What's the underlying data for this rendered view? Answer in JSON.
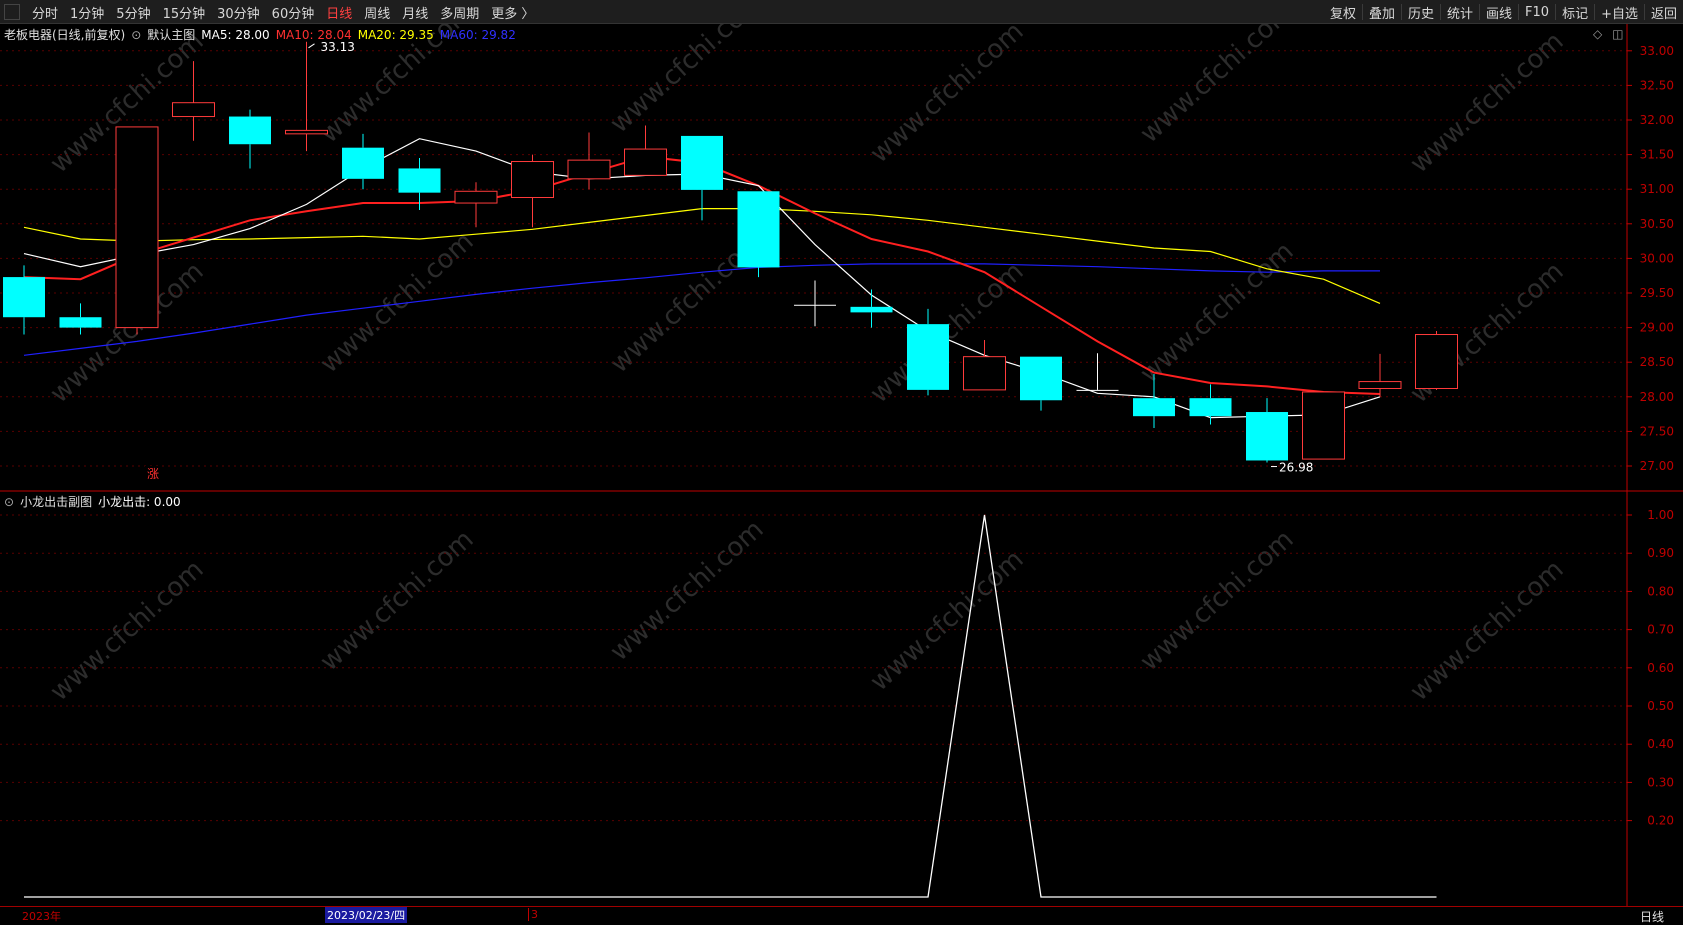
{
  "toolbar": {
    "left": [
      "分时",
      "1分钟",
      "5分钟",
      "15分钟",
      "30分钟",
      "60分钟",
      "日线",
      "周线",
      "月线",
      "多周期",
      "更多 〉"
    ],
    "active": "日线",
    "right": [
      "复权",
      "叠加",
      "历史",
      "统计",
      "画线",
      "F10",
      "标记",
      "+自选",
      "返回"
    ]
  },
  "main_header": {
    "stock": "老板电器(日线,前复权)",
    "template": "默认主图",
    "ma5": "MA5: 28.00",
    "ma10": "MA10: 28.04",
    "ma20": "MA20: 29.35",
    "ma60": "MA60: 29.82"
  },
  "sub_header": {
    "name": "小龙出击副图",
    "value": "小龙出击: 0.00"
  },
  "annotations": {
    "high_label": "33.13",
    "low_label": "26.98",
    "zhang_marker": "涨"
  },
  "bottom": {
    "year": "2023年",
    "cursor_date": "2023/02/23/四",
    "month": "3",
    "period": "日线"
  },
  "watermark": "www.cfchi.com",
  "colors": {
    "up": "#ff3b3b",
    "down": "#00ffff",
    "ma5": "#ffffff",
    "ma10": "#ff2020",
    "ma20": "#ffff00",
    "ma60": "#2020ff",
    "axis": "#c00000"
  },
  "chart_data": [
    {
      "type": "candlestick",
      "title": "老板电器(日线,前复权)",
      "ylim": [
        26.7,
        33.3
      ],
      "y_ticks": [
        "27.00",
        "27.50",
        "28.00",
        "28.50",
        "29.00",
        "29.50",
        "30.00",
        "30.50",
        "31.00",
        "31.50",
        "32.00",
        "32.50",
        "33.00"
      ],
      "candles": [
        {
          "open": 29.73,
          "close": 29.15,
          "high": 29.9,
          "low": 28.9
        },
        {
          "open": 29.15,
          "close": 29.0,
          "high": 29.35,
          "low": 28.9
        },
        {
          "open": 29.0,
          "close": 31.9,
          "high": 31.9,
          "low": 28.9
        },
        {
          "open": 32.05,
          "close": 32.25,
          "high": 32.85,
          "low": 31.7
        },
        {
          "open": 32.05,
          "close": 31.65,
          "high": 32.15,
          "low": 31.3
        },
        {
          "open": 31.8,
          "close": 31.85,
          "high": 33.13,
          "low": 31.55
        },
        {
          "open": 31.6,
          "close": 31.15,
          "high": 31.8,
          "low": 31.0
        },
        {
          "open": 31.3,
          "close": 30.95,
          "high": 31.45,
          "low": 30.7
        },
        {
          "open": 30.8,
          "close": 30.97,
          "high": 31.1,
          "low": 30.45
        },
        {
          "open": 30.88,
          "close": 31.4,
          "high": 31.5,
          "low": 30.45
        },
        {
          "open": 31.15,
          "close": 31.42,
          "high": 31.82,
          "low": 31.0
        },
        {
          "open": 31.2,
          "close": 31.58,
          "high": 31.92,
          "low": 31.2
        },
        {
          "open": 31.77,
          "close": 30.99,
          "high": 31.77,
          "low": 30.55
        },
        {
          "open": 30.97,
          "close": 29.87,
          "high": 30.97,
          "low": 29.73
        },
        {
          "open": 29.33,
          "close": 29.33,
          "high": 29.68,
          "low": 29.02
        },
        {
          "open": 29.3,
          "close": 29.22,
          "high": 29.55,
          "low": 29.0
        },
        {
          "open": 29.05,
          "close": 28.1,
          "high": 29.27,
          "low": 28.02
        },
        {
          "open": 28.1,
          "close": 28.58,
          "high": 28.82,
          "low": 28.1
        },
        {
          "open": 28.58,
          "close": 27.95,
          "high": 28.58,
          "low": 27.8
        },
        {
          "open": 28.1,
          "close": 28.1,
          "high": 28.63,
          "low": 28.1
        },
        {
          "open": 27.98,
          "close": 27.72,
          "high": 28.33,
          "low": 27.55
        },
        {
          "open": 27.98,
          "close": 27.72,
          "high": 28.18,
          "low": 27.6
        },
        {
          "open": 27.78,
          "close": 27.08,
          "high": 27.98,
          "low": 27.05
        },
        {
          "open": 27.1,
          "close": 28.07,
          "high": 28.07,
          "low": 27.1
        },
        {
          "open": 28.12,
          "close": 28.22,
          "high": 28.62,
          "low": 28.0
        },
        {
          "open": 28.12,
          "close": 28.9,
          "high": 28.95,
          "low": 28.1
        }
      ],
      "series": [
        {
          "name": "MA5",
          "values": [
            30.07,
            29.88,
            30.05,
            30.2,
            30.43,
            30.78,
            31.3,
            31.73,
            31.55,
            31.25,
            31.15,
            31.2,
            31.22,
            31.05,
            30.2,
            29.47,
            28.95,
            28.6,
            28.35,
            28.05,
            28.0,
            27.7,
            27.72,
            27.74,
            28.0
          ]
        },
        {
          "name": "MA10",
          "values": [
            29.73,
            29.7,
            30.05,
            30.3,
            30.55,
            30.68,
            30.8,
            30.8,
            30.83,
            30.98,
            31.23,
            31.47,
            31.38,
            31.05,
            30.65,
            30.28,
            30.1,
            29.8,
            29.3,
            28.8,
            28.35,
            28.2,
            28.15,
            28.07,
            28.04
          ]
        },
        {
          "name": "MA20",
          "values": [
            30.45,
            30.28,
            30.25,
            30.27,
            30.28,
            30.3,
            30.32,
            30.28,
            30.35,
            30.42,
            30.52,
            30.62,
            30.72,
            30.72,
            30.68,
            30.63,
            30.55,
            30.45,
            30.35,
            30.25,
            30.15,
            30.1,
            29.85,
            29.7,
            29.35
          ]
        },
        {
          "name": "MA60",
          "values": [
            28.6,
            28.7,
            28.8,
            28.92,
            29.05,
            29.18,
            29.28,
            29.38,
            29.48,
            29.57,
            29.65,
            29.72,
            29.8,
            29.87,
            29.9,
            29.92,
            29.92,
            29.92,
            29.9,
            29.88,
            29.85,
            29.82,
            29.8,
            29.82,
            29.82
          ]
        }
      ]
    },
    {
      "type": "line",
      "title": "小龙出击副图",
      "ylim": [
        0,
        1.05
      ],
      "y_ticks": [
        "0.20",
        "0.30",
        "0.40",
        "0.50",
        "0.60",
        "0.70",
        "0.80",
        "0.90",
        "1.00"
      ],
      "series": [
        {
          "name": "小龙出击",
          "values": [
            0,
            0,
            0,
            0,
            0,
            0,
            0,
            0,
            0,
            0,
            0,
            0,
            0,
            0,
            0,
            0,
            0,
            1,
            0,
            0,
            0,
            0,
            0,
            0,
            0,
            0
          ]
        }
      ]
    }
  ]
}
